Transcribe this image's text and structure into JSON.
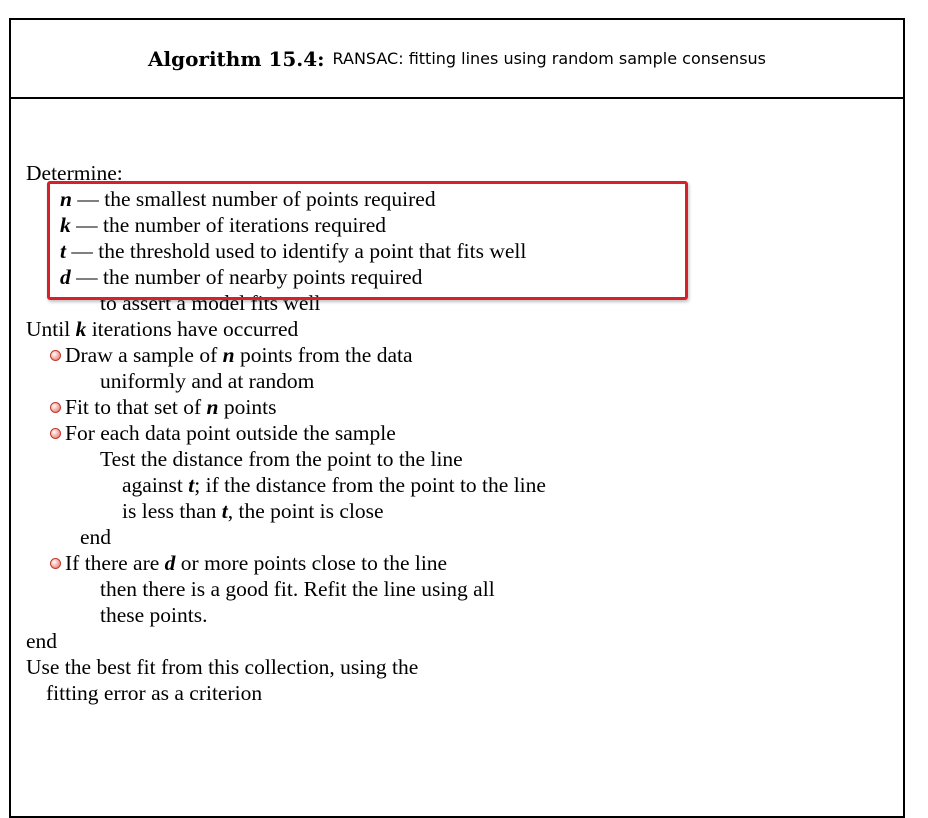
{
  "header": {
    "algorithm_number": "Algorithm 15.4:",
    "title": "RANSAC: fitting lines using random sample consensus"
  },
  "colors": {
    "highlight_border": "#d6212a",
    "bullet": "#e06a5e"
  },
  "lines": [
    {
      "parts": [
        {
          "t": "Determine:"
        }
      ]
    },
    {
      "parts": [
        {
          "t": "n",
          "v": true
        },
        {
          "t": " — the smallest number of points required"
        }
      ]
    },
    {
      "parts": [
        {
          "t": "k",
          "v": true
        },
        {
          "t": " — the number of iterations required"
        }
      ]
    },
    {
      "parts": [
        {
          "t": "t",
          "v": true
        },
        {
          "t": " — the threshold used to identify a point that fits well"
        }
      ]
    },
    {
      "parts": [
        {
          "t": "d",
          "v": true
        },
        {
          "t": " — the number of nearby points required"
        }
      ]
    },
    {
      "parts": [
        {
          "t": "to assert a model fits well"
        }
      ]
    },
    {
      "parts": [
        {
          "t": "Until "
        },
        {
          "t": "k",
          "v": true
        },
        {
          "t": " iterations have occurred"
        }
      ]
    },
    {
      "parts": [
        {
          "t": "Draw a sample of "
        },
        {
          "t": "n",
          "v": true
        },
        {
          "t": " points from the data"
        }
      ],
      "bullet": true
    },
    {
      "parts": [
        {
          "t": "uniformly and at random"
        }
      ]
    },
    {
      "parts": [
        {
          "t": "Fit to that set of "
        },
        {
          "t": "n",
          "v": true
        },
        {
          "t": " points"
        }
      ],
      "bullet": true
    },
    {
      "parts": [
        {
          "t": "For each data point outside the sample"
        }
      ],
      "bullet": true
    },
    {
      "parts": [
        {
          "t": "Test the distance from the point to the line"
        }
      ]
    },
    {
      "parts": [
        {
          "t": "against "
        },
        {
          "t": "t",
          "v": true
        },
        {
          "t": "; if the distance from the point to the line"
        }
      ]
    },
    {
      "parts": [
        {
          "t": "is less than "
        },
        {
          "t": "t",
          "v": true
        },
        {
          "t": ", the point is close"
        }
      ]
    },
    {
      "parts": [
        {
          "t": "end"
        }
      ]
    },
    {
      "parts": [
        {
          "t": "If there are "
        },
        {
          "t": "d",
          "v": true
        },
        {
          "t": " or more points close to the line"
        }
      ],
      "bullet": true
    },
    {
      "parts": [
        {
          "t": "then there is a good fit. Refit the line using all"
        }
      ]
    },
    {
      "parts": [
        {
          "t": "these points."
        }
      ]
    },
    {
      "parts": [
        {
          "t": "end"
        }
      ]
    },
    {
      "parts": [
        {
          "t": "Use the best fit from this collection, using the"
        }
      ]
    },
    {
      "parts": [
        {
          "t": "fitting error as a criterion"
        }
      ]
    }
  ]
}
